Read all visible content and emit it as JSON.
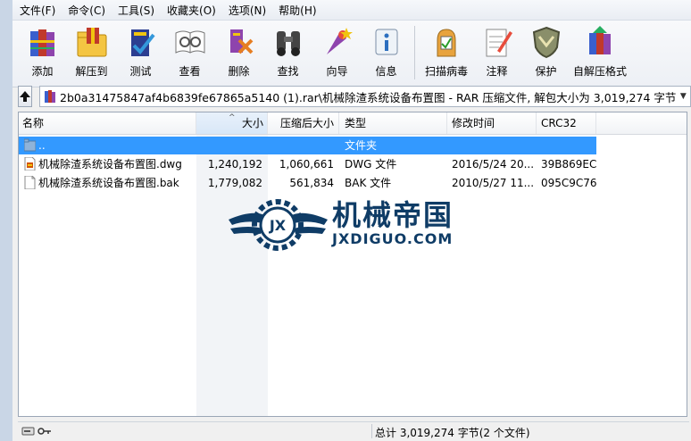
{
  "menu": [
    "文件(F)",
    "命令(C)",
    "工具(S)",
    "收藏夹(O)",
    "选项(N)",
    "帮助(H)"
  ],
  "toolbar": {
    "buttons": [
      {
        "label": "添加",
        "icon": "books-add-icon"
      },
      {
        "label": "解压到",
        "icon": "extract-folder-icon"
      },
      {
        "label": "测试",
        "icon": "test-checkmark-icon"
      },
      {
        "label": "查看",
        "icon": "view-book-icon"
      },
      {
        "label": "删除",
        "icon": "delete-icon"
      },
      {
        "label": "查找",
        "icon": "binoculars-icon"
      },
      {
        "label": "向导",
        "icon": "wizard-icon"
      },
      {
        "label": "信息",
        "icon": "info-icon"
      },
      {
        "label": "扫描病毒",
        "icon": "virus-scan-icon"
      },
      {
        "label": "注释",
        "icon": "comment-pencil-icon"
      },
      {
        "label": "保护",
        "icon": "shield-protect-icon"
      },
      {
        "label": "自解压格式",
        "icon": "sfx-archive-icon"
      }
    ]
  },
  "address": {
    "path": "2b0a31475847af4b6839fe67865a5140 (1).rar\\机械除渣系统设备布置图 - RAR 压缩文件, 解包大小为 3,019,274 字节"
  },
  "columns": [
    "名称",
    "大小",
    "压缩后大小",
    "类型",
    "修改时间",
    "CRC32"
  ],
  "files": [
    {
      "name": "..",
      "size": "",
      "packed": "",
      "type": "文件夹",
      "modified": "",
      "crc": "",
      "selected": true,
      "icon": "folder-up-icon"
    },
    {
      "name": "机械除渣系统设备布置图.dwg",
      "size": "1,240,192",
      "packed": "1,060,661",
      "type": "DWG 文件",
      "modified": "2016/5/24 20...",
      "crc": "39B869EC",
      "selected": false,
      "icon": "dwg-file-icon"
    },
    {
      "name": "机械除渣系统设备布置图.bak",
      "size": "1,779,082",
      "packed": "561,834",
      "type": "BAK 文件",
      "modified": "2010/5/27 11...",
      "crc": "095C9C76",
      "selected": false,
      "icon": "blank-file-icon"
    }
  ],
  "watermark": {
    "cn": "机械帝国",
    "en": "JXDIGUO.COM",
    "badge": "JX"
  },
  "status": {
    "text": "总计 3,019,274 字节(2 个文件)"
  },
  "colors": {
    "selection": "#3399ff",
    "brand": "#0f3c66"
  }
}
